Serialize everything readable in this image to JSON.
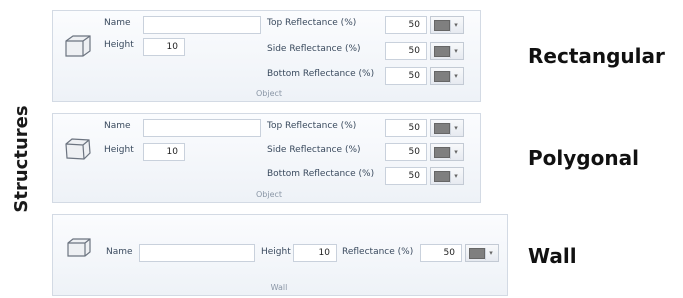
{
  "side_title": "Structures",
  "rectangular": {
    "heading": "Rectangular",
    "name_label": "Name",
    "name_value": "",
    "height_label": "Height",
    "height_value": "10",
    "top_label": "Top Reflectance (%)",
    "top_value": "50",
    "side_label": "Side Reflectance (%)",
    "side_value": "50",
    "bottom_label": "Bottom Reflectance (%)",
    "bottom_value": "50",
    "group_caption": "Object",
    "swatch_color": "#7f7f7f"
  },
  "polygonal": {
    "heading": "Polygonal",
    "name_label": "Name",
    "name_value": "",
    "height_label": "Height",
    "height_value": "10",
    "top_label": "Top Reflectance (%)",
    "top_value": "50",
    "side_label": "Side Reflectance (%)",
    "side_value": "50",
    "bottom_label": "Bottom Reflectance (%)",
    "bottom_value": "50",
    "group_caption": "Object",
    "swatch_color": "#7f7f7f"
  },
  "wall": {
    "heading": "Wall",
    "name_label": "Name",
    "name_value": "",
    "height_label": "Height",
    "height_value": "10",
    "reflectance_label": "Reflectance (%)",
    "reflectance_value": "50",
    "group_caption": "Wall",
    "swatch_color": "#7f7f7f"
  }
}
